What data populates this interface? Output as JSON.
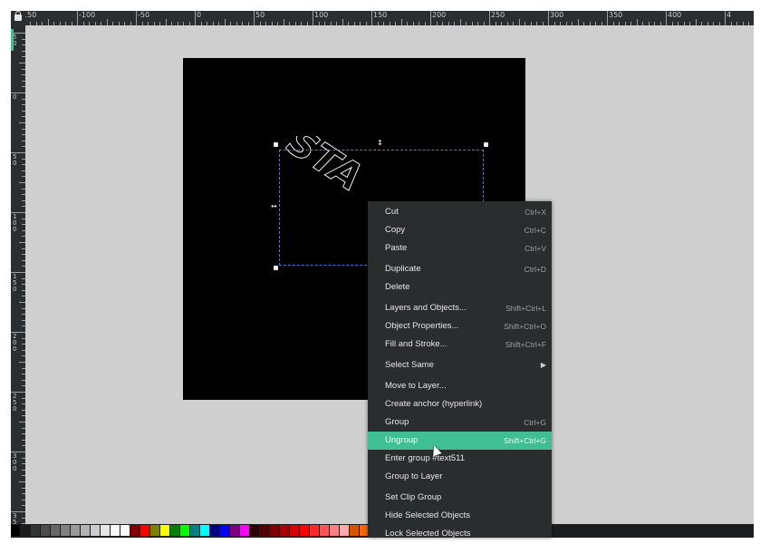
{
  "ruler": {
    "h_labels": [
      "-150",
      "-100",
      "-50",
      "0",
      "50",
      "100",
      "150",
      "200",
      "250",
      "300",
      "350",
      "400",
      "4"
    ],
    "v_labels": [
      "5\n0",
      "0",
      "5\n0",
      "1\n0\n0",
      "1\n5\n0",
      "2\n0\n0",
      "2\n5\n0",
      "3\n0\n0",
      "3\n5"
    ]
  },
  "canvas_text": "STA",
  "colors": {
    "accent": "#3fbf93",
    "menu_bg": "#2a2d2e",
    "canvas_bg": "#cfcfcf",
    "page_bg": "#000000",
    "selection": "#4b78d8"
  },
  "palette": [
    "#000000",
    "#1a1a1a",
    "#333333",
    "#4d4d4d",
    "#666666",
    "#808080",
    "#999999",
    "#b3b3b3",
    "#cccccc",
    "#e6e6e6",
    "#ffffff",
    "#ffffff",
    "#800000",
    "#ff0000",
    "#808000",
    "#ffff00",
    "#008000",
    "#00ff00",
    "#008080",
    "#00ffff",
    "#000080",
    "#0000ff",
    "#800080",
    "#ff00ff",
    "#2b0000",
    "#550000",
    "#800000",
    "#aa0000",
    "#d40000",
    "#ff0000",
    "#ff2a2a",
    "#ff5555",
    "#ff8080",
    "#ffaaaa",
    "#d45500",
    "#ff6600",
    "#ff7f2a",
    "#ff9955",
    "#ffb380",
    "#ffccaa",
    "#2b1100",
    "#552200",
    "#803300",
    "#aa4400",
    "#d45500",
    "#ff6600",
    "#ff7f2a",
    "#ff9955",
    "#ffb380",
    "#ffccaa",
    "#ffe6d5",
    "#552200"
  ],
  "menu": {
    "items": [
      {
        "label": "Cut",
        "shortcut": "Ctrl+X"
      },
      {
        "label": "Copy",
        "shortcut": "Ctrl+C"
      },
      {
        "label": "Paste",
        "shortcut": "Ctrl+V"
      },
      {
        "label": "Duplicate",
        "shortcut": "Ctrl+D"
      },
      {
        "label": "Delete",
        "shortcut": ""
      },
      {
        "label": "Layers and Objects...",
        "shortcut": "Shift+Ctrl+L"
      },
      {
        "label": "Object Properties...",
        "shortcut": "Shift+Ctrl+O"
      },
      {
        "label": "Fill and Stroke...",
        "shortcut": "Shift+Ctrl+F"
      },
      {
        "label": "Select Same",
        "shortcut": ""
      },
      {
        "label": "Move to Layer...",
        "shortcut": ""
      },
      {
        "label": "Create anchor (hyperlink)",
        "shortcut": ""
      },
      {
        "label": "Group",
        "shortcut": "Ctrl+G"
      },
      {
        "label": "Ungroup",
        "shortcut": "Shift+Ctrl+G"
      },
      {
        "label": "Enter group #text511",
        "shortcut": ""
      },
      {
        "label": "Group to Layer",
        "shortcut": ""
      },
      {
        "label": "Set Clip Group",
        "shortcut": ""
      },
      {
        "label": "Hide Selected Objects",
        "shortcut": ""
      },
      {
        "label": "Lock Selected Objects",
        "shortcut": ""
      }
    ]
  }
}
